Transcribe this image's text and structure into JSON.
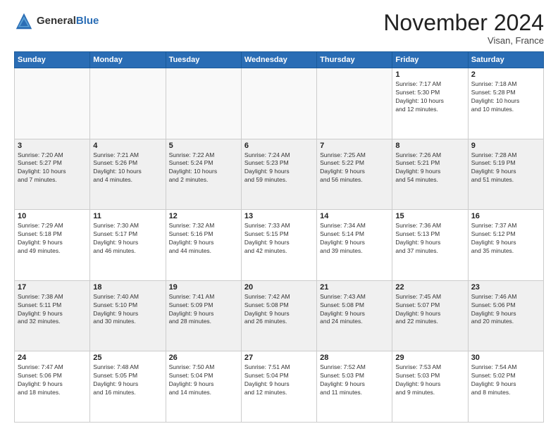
{
  "header": {
    "logo_general": "General",
    "logo_blue": "Blue",
    "month": "November 2024",
    "location": "Visan, France"
  },
  "weekdays": [
    "Sunday",
    "Monday",
    "Tuesday",
    "Wednesday",
    "Thursday",
    "Friday",
    "Saturday"
  ],
  "weeks": [
    [
      {
        "day": "",
        "info": ""
      },
      {
        "day": "",
        "info": ""
      },
      {
        "day": "",
        "info": ""
      },
      {
        "day": "",
        "info": ""
      },
      {
        "day": "",
        "info": ""
      },
      {
        "day": "1",
        "info": "Sunrise: 7:17 AM\nSunset: 5:30 PM\nDaylight: 10 hours\nand 12 minutes."
      },
      {
        "day": "2",
        "info": "Sunrise: 7:18 AM\nSunset: 5:28 PM\nDaylight: 10 hours\nand 10 minutes."
      }
    ],
    [
      {
        "day": "3",
        "info": "Sunrise: 7:20 AM\nSunset: 5:27 PM\nDaylight: 10 hours\nand 7 minutes."
      },
      {
        "day": "4",
        "info": "Sunrise: 7:21 AM\nSunset: 5:26 PM\nDaylight: 10 hours\nand 4 minutes."
      },
      {
        "day": "5",
        "info": "Sunrise: 7:22 AM\nSunset: 5:24 PM\nDaylight: 10 hours\nand 2 minutes."
      },
      {
        "day": "6",
        "info": "Sunrise: 7:24 AM\nSunset: 5:23 PM\nDaylight: 9 hours\nand 59 minutes."
      },
      {
        "day": "7",
        "info": "Sunrise: 7:25 AM\nSunset: 5:22 PM\nDaylight: 9 hours\nand 56 minutes."
      },
      {
        "day": "8",
        "info": "Sunrise: 7:26 AM\nSunset: 5:21 PM\nDaylight: 9 hours\nand 54 minutes."
      },
      {
        "day": "9",
        "info": "Sunrise: 7:28 AM\nSunset: 5:19 PM\nDaylight: 9 hours\nand 51 minutes."
      }
    ],
    [
      {
        "day": "10",
        "info": "Sunrise: 7:29 AM\nSunset: 5:18 PM\nDaylight: 9 hours\nand 49 minutes."
      },
      {
        "day": "11",
        "info": "Sunrise: 7:30 AM\nSunset: 5:17 PM\nDaylight: 9 hours\nand 46 minutes."
      },
      {
        "day": "12",
        "info": "Sunrise: 7:32 AM\nSunset: 5:16 PM\nDaylight: 9 hours\nand 44 minutes."
      },
      {
        "day": "13",
        "info": "Sunrise: 7:33 AM\nSunset: 5:15 PM\nDaylight: 9 hours\nand 42 minutes."
      },
      {
        "day": "14",
        "info": "Sunrise: 7:34 AM\nSunset: 5:14 PM\nDaylight: 9 hours\nand 39 minutes."
      },
      {
        "day": "15",
        "info": "Sunrise: 7:36 AM\nSunset: 5:13 PM\nDaylight: 9 hours\nand 37 minutes."
      },
      {
        "day": "16",
        "info": "Sunrise: 7:37 AM\nSunset: 5:12 PM\nDaylight: 9 hours\nand 35 minutes."
      }
    ],
    [
      {
        "day": "17",
        "info": "Sunrise: 7:38 AM\nSunset: 5:11 PM\nDaylight: 9 hours\nand 32 minutes."
      },
      {
        "day": "18",
        "info": "Sunrise: 7:40 AM\nSunset: 5:10 PM\nDaylight: 9 hours\nand 30 minutes."
      },
      {
        "day": "19",
        "info": "Sunrise: 7:41 AM\nSunset: 5:09 PM\nDaylight: 9 hours\nand 28 minutes."
      },
      {
        "day": "20",
        "info": "Sunrise: 7:42 AM\nSunset: 5:08 PM\nDaylight: 9 hours\nand 26 minutes."
      },
      {
        "day": "21",
        "info": "Sunrise: 7:43 AM\nSunset: 5:08 PM\nDaylight: 9 hours\nand 24 minutes."
      },
      {
        "day": "22",
        "info": "Sunrise: 7:45 AM\nSunset: 5:07 PM\nDaylight: 9 hours\nand 22 minutes."
      },
      {
        "day": "23",
        "info": "Sunrise: 7:46 AM\nSunset: 5:06 PM\nDaylight: 9 hours\nand 20 minutes."
      }
    ],
    [
      {
        "day": "24",
        "info": "Sunrise: 7:47 AM\nSunset: 5:06 PM\nDaylight: 9 hours\nand 18 minutes."
      },
      {
        "day": "25",
        "info": "Sunrise: 7:48 AM\nSunset: 5:05 PM\nDaylight: 9 hours\nand 16 minutes."
      },
      {
        "day": "26",
        "info": "Sunrise: 7:50 AM\nSunset: 5:04 PM\nDaylight: 9 hours\nand 14 minutes."
      },
      {
        "day": "27",
        "info": "Sunrise: 7:51 AM\nSunset: 5:04 PM\nDaylight: 9 hours\nand 12 minutes."
      },
      {
        "day": "28",
        "info": "Sunrise: 7:52 AM\nSunset: 5:03 PM\nDaylight: 9 hours\nand 11 minutes."
      },
      {
        "day": "29",
        "info": "Sunrise: 7:53 AM\nSunset: 5:03 PM\nDaylight: 9 hours\nand 9 minutes."
      },
      {
        "day": "30",
        "info": "Sunrise: 7:54 AM\nSunset: 5:02 PM\nDaylight: 9 hours\nand 8 minutes."
      }
    ]
  ]
}
